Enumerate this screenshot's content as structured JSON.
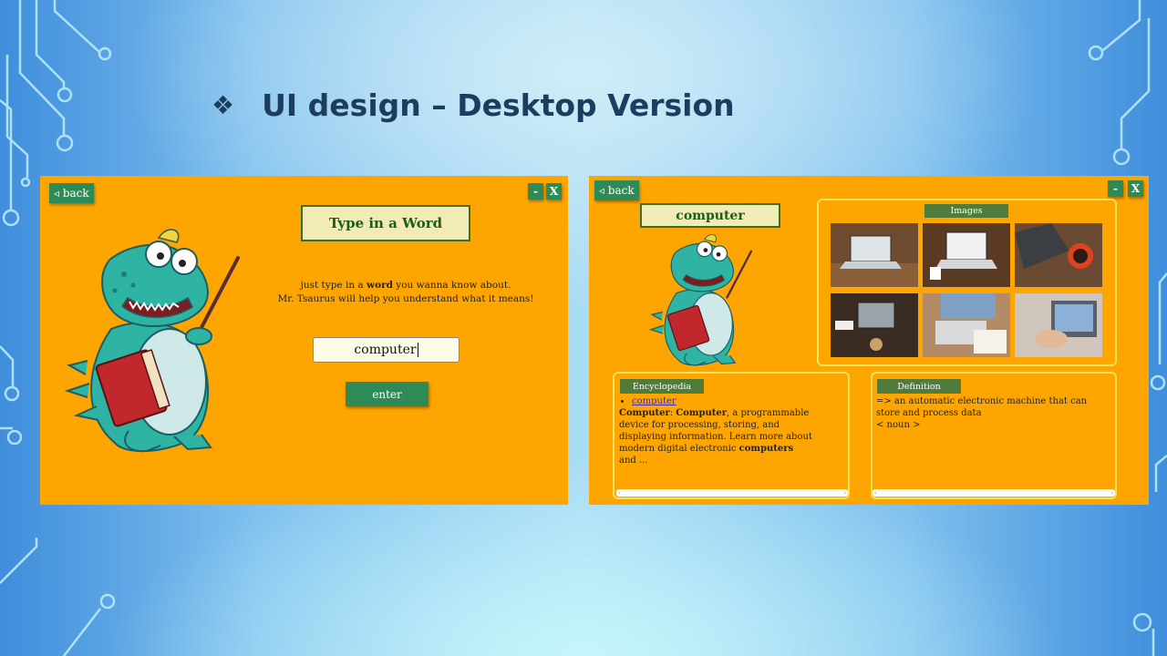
{
  "slide": {
    "bullet": "❖",
    "title": "UI design – Desktop Version"
  },
  "screen1": {
    "back_label": "◃ back",
    "minimize_label": "-",
    "close_label": "X",
    "heading": "Type in a Word",
    "instructions": {
      "line1_pre": "just type in a ",
      "line1_bold": "word",
      "line1_post": " you wanna know about.",
      "line2": "Mr. Tsaurus will help you understand what it means!"
    },
    "input_value": "computer",
    "enter_label": "enter"
  },
  "screen2": {
    "back_label": "◃ back",
    "minimize_label": "-",
    "close_label": "X",
    "word": "computer",
    "images_label": "Images",
    "encyclopedia": {
      "label": "Encyclopedia",
      "link": "computer",
      "term_a": "Computer",
      "term_b": "Computer",
      "text_1": ", a programmable device for processing, storing, and",
      "text_2": "displaying information. Learn more about modern digital electronic ",
      "term_c": "computers",
      "text_3": "and ..."
    },
    "definition": {
      "label": "Definition",
      "line1": "=> an automatic electronic machine that can store and process data",
      "line2": "< noun >"
    },
    "scroll_left": "‹",
    "scroll_right": "›"
  },
  "colors": {
    "panel": "#ffa500",
    "button": "#2e8b57",
    "title": "#1c3d5e",
    "tag": "#4f7b3b",
    "frame": "#f4e15a"
  }
}
